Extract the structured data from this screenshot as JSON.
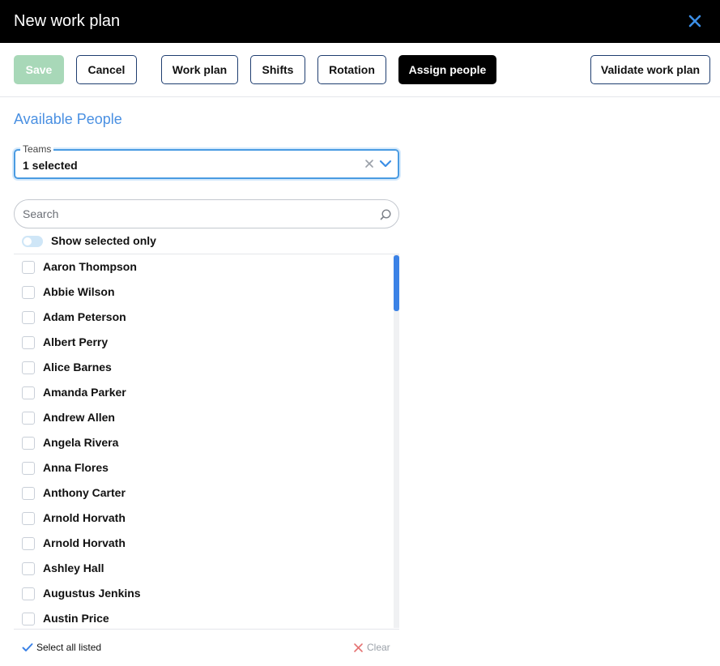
{
  "window": {
    "title": "New work plan"
  },
  "toolbar": {
    "save": "Save",
    "cancel": "Cancel",
    "work_plan": "Work plan",
    "shifts": "Shifts",
    "rotation": "Rotation",
    "assign_people": "Assign people",
    "validate": "Validate work plan"
  },
  "available": {
    "title": "Available People",
    "teams": {
      "label": "Teams",
      "value": "1 selected"
    },
    "search": {
      "placeholder": "Search",
      "value": ""
    },
    "toggle": {
      "label": "Show selected only",
      "on": false
    },
    "people": [
      {
        "name": "Aaron Thompson",
        "checked": false
      },
      {
        "name": "Abbie Wilson",
        "checked": false
      },
      {
        "name": "Adam Peterson",
        "checked": false
      },
      {
        "name": "Albert Perry",
        "checked": false
      },
      {
        "name": "Alice Barnes",
        "checked": false
      },
      {
        "name": "Amanda Parker",
        "checked": false
      },
      {
        "name": "Andrew Allen",
        "checked": false
      },
      {
        "name": "Angela Rivera",
        "checked": false
      },
      {
        "name": "Anna Flores",
        "checked": false
      },
      {
        "name": "Anthony Carter",
        "checked": false
      },
      {
        "name": "Arnold Horvath",
        "checked": false
      },
      {
        "name": "Arnold Horvath",
        "checked": false
      },
      {
        "name": "Ashley Hall",
        "checked": false
      },
      {
        "name": "Augustus Jenkins",
        "checked": false
      },
      {
        "name": "Austin Price",
        "checked": false
      }
    ],
    "footer": {
      "select_all": "Select all listed",
      "clear": "Clear"
    }
  },
  "colors": {
    "accent": "#4a90e2",
    "save_disabled": "#a8d8b8",
    "active_tab": "#000000",
    "clear_icon": "#e57373",
    "check_icon": "#3b82e6"
  }
}
